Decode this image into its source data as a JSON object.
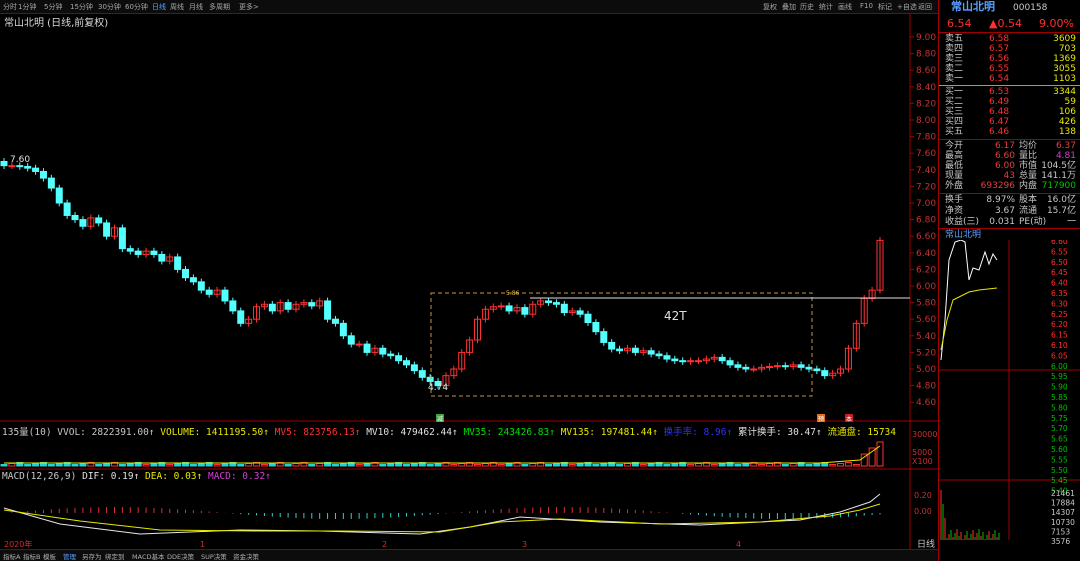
{
  "periods": [
    "分时",
    "1分钟",
    "5分钟",
    "15分钟",
    "30分钟",
    "60分钟",
    "日线",
    "周线",
    "月线",
    "多周期",
    "更多>"
  ],
  "tools": [
    "复权",
    "叠加",
    "历史",
    "统计",
    "画线",
    "F10",
    "标记",
    "+自选",
    "返回"
  ],
  "chart_title": "常山北明 (日线,前复权)",
  "price_axis": [
    "9.00",
    "8.80",
    "8.60",
    "8.40",
    "8.20",
    "8.00",
    "7.80",
    "7.60",
    "7.40",
    "7.20",
    "7.00",
    "6.80",
    "6.60",
    "6.40",
    "6.20",
    "6.00",
    "5.80",
    "5.60",
    "5.40",
    "5.20",
    "5.00",
    "4.80",
    "4.60"
  ],
  "annot": {
    "high": "7.60",
    "low": "4.74",
    "box_top": "5.86",
    "box_label": "42T"
  },
  "vol_line": {
    "label": "135量(10)",
    "vvol": "VVOL: 2822391.00↑",
    "volume": "VOLUME: 1411195.50↑",
    "mv5": "MV5: 823756.13↑",
    "mv10": "MV10: 479462.44↑",
    "mv35": "MV35: 243426.83↑",
    "mv135": "MV135: 197481.44↑",
    "turnover": "换手率: 8.96↑",
    "cum_turnover": "累计换手: 30.47↑",
    "float": "流通盘: 15734"
  },
  "vol_axis": [
    "30000",
    "5000",
    "X100"
  ],
  "macd_line": {
    "label": "MACD(12,26,9)",
    "dif": "DIF: 0.19↑",
    "dea": "DEA: 0.03↑",
    "macd": "MACD: 0.32↑"
  },
  "macd_axis": [
    "0.20",
    "0.00"
  ],
  "dates": [
    "2020年",
    "1",
    "2",
    "3",
    "4"
  ],
  "markers": {
    "m1": "减",
    "m2": "预",
    "m3": "本"
  },
  "bottom_tabs": [
    "指标A",
    "指标B",
    "模板",
    "管理",
    "另存为",
    "绑定到",
    "MACD基本",
    "DDE决策",
    "SUP决策",
    "资金决策"
  ],
  "stock": {
    "name": "常山北明",
    "code": "000158",
    "price": "6.54",
    "change": "▲0.54",
    "pct": "9.00%"
  },
  "asks": [
    {
      "label": "卖五",
      "price": "6.58",
      "vol": "3609"
    },
    {
      "label": "卖四",
      "price": "6.57",
      "vol": "703"
    },
    {
      "label": "卖三",
      "price": "6.56",
      "vol": "1369"
    },
    {
      "label": "卖二",
      "price": "6.55",
      "vol": "3055"
    },
    {
      "label": "卖一",
      "price": "6.54",
      "vol": "1103"
    }
  ],
  "bids": [
    {
      "label": "买一",
      "price": "6.53",
      "vol": "3344"
    },
    {
      "label": "买二",
      "price": "6.49",
      "vol": "59"
    },
    {
      "label": "买三",
      "price": "6.48",
      "vol": "106"
    },
    {
      "label": "买四",
      "price": "6.47",
      "vol": "426"
    },
    {
      "label": "买五",
      "price": "6.46",
      "vol": "138"
    }
  ],
  "stats": [
    {
      "l1": "今开",
      "v1": "6.17",
      "l2": "均价",
      "v2": "6.37",
      "c1": "#e04040",
      "c2": "#e04040"
    },
    {
      "l1": "最高",
      "v1": "6.60",
      "l2": "量比",
      "v2": "4.81",
      "c1": "#e04040",
      "c2": "#d040d0"
    },
    {
      "l1": "最低",
      "v1": "6.00",
      "l2": "市值",
      "v2": "104.5亿",
      "c1": "#e04040",
      "c2": "#c8c8c8"
    },
    {
      "l1": "现量",
      "v1": "43",
      "l2": "总量",
      "v2": "141.1万",
      "c1": "#e04040",
      "c2": "#c8c8c8"
    },
    {
      "l1": "外盘",
      "v1": "693296",
      "l2": "内盘",
      "v2": "717900",
      "c1": "#e04040",
      "c2": "#00c000"
    }
  ],
  "stats2": [
    {
      "l1": "换手",
      "v1": "8.97%",
      "l2": "股本",
      "v2": "16.0亿"
    },
    {
      "l1": "净资",
      "v1": "3.67",
      "l2": "流通",
      "v2": "15.7亿"
    },
    {
      "l1": "收益(三)",
      "v1": "0.031",
      "l2": "PE(动)",
      "v2": "一"
    }
  ],
  "mini_title": "常山北明",
  "mini_axis_left": [
    "6.60",
    "6.55",
    "6.50",
    "6.45",
    "6.40",
    "6.35",
    "6.30",
    "6.25",
    "6.20",
    "6.15",
    "6.10",
    "6.05",
    "6.00",
    "5.95",
    "5.90",
    "5.85",
    "5.80",
    "5.75",
    "5.70",
    "5.65",
    "5.60",
    "5.55",
    "5.50",
    "5.45",
    "5.40"
  ],
  "mini_vol_axis": [
    "21461",
    "17884",
    "14307",
    "10730",
    "7153",
    "3576"
  ],
  "mini_tab": "日线",
  "colors": {
    "up": "#ff3232",
    "down": "#54ffff",
    "bg": "#000000"
  }
}
